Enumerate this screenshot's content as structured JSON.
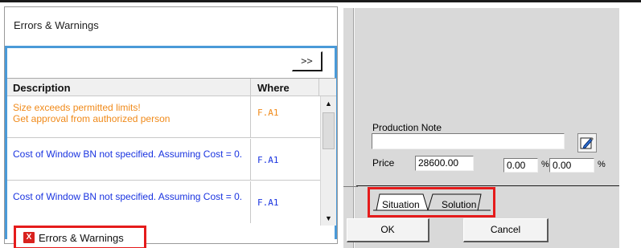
{
  "errors_panel": {
    "title": "Errors & Warnings",
    "expand_label": ">>",
    "columns": {
      "description": "Description",
      "where": "Where"
    },
    "rows": [
      {
        "type": "warning",
        "description": "Size exceeds permitted limits!\nGet approval from authorized person",
        "where": "F.A1"
      },
      {
        "type": "error",
        "description": "Cost of Window BN not specified. Assuming Cost = 0.",
        "where": "F.A1"
      },
      {
        "type": "error",
        "description": "Cost of Window BN not specified. Assuming Cost = 0.",
        "where": "F.A1"
      }
    ],
    "tab_label": "Errors & Warnings",
    "colors": {
      "warning": "#f08a1a",
      "error": "#1a34e0",
      "highlight": "#e51b1b",
      "accent": "#4a9ad8"
    }
  },
  "dialog": {
    "production_note_label": "Production Note",
    "production_note_value": "",
    "price_label": "Price",
    "price_value": "28600.00",
    "percent_1": "0.00",
    "percent_2": "0.00",
    "percent_sign": "%",
    "tabs": [
      "Situation",
      "Solution"
    ],
    "ok_label": "OK",
    "cancel_label": "Cancel"
  },
  "icons": [
    "scroll-up-icon",
    "scroll-down-icon",
    "error-x-icon",
    "edit-note-icon"
  ]
}
